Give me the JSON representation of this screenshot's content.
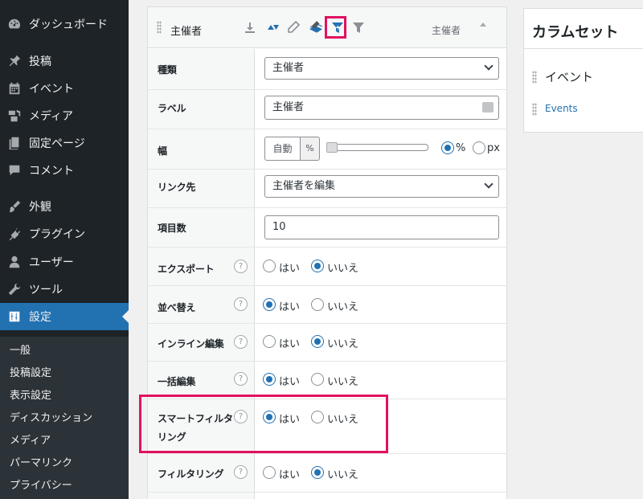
{
  "sidebar": {
    "items": [
      {
        "label": "ダッシュボード",
        "icon": "dashboard-icon"
      },
      {
        "label": "投稿",
        "icon": "pin-icon"
      },
      {
        "label": "イベント",
        "icon": "calendar-icon"
      },
      {
        "label": "メディア",
        "icon": "media-icon"
      },
      {
        "label": "固定ページ",
        "icon": "pages-icon"
      },
      {
        "label": "コメント",
        "icon": "comment-icon"
      },
      {
        "label": "外観",
        "icon": "brush-icon"
      },
      {
        "label": "プラグイン",
        "icon": "plugin-icon"
      },
      {
        "label": "ユーザー",
        "icon": "user-icon"
      },
      {
        "label": "ツール",
        "icon": "wrench-icon"
      },
      {
        "label": "設定",
        "icon": "settings-icon"
      }
    ],
    "submenu": [
      "一般",
      "投稿設定",
      "表示設定",
      "ディスカッション",
      "メディア",
      "パーマリンク",
      "プライバシー"
    ]
  },
  "column": {
    "header_title": "主催者",
    "header_label": "主催者",
    "icons": [
      "download-icon",
      "sort-icon",
      "edit-icon",
      "bulk-edit-icon",
      "smart-filter-icon",
      "filter-icon"
    ],
    "fields": {
      "type": {
        "label": "種類",
        "value": "主催者"
      },
      "column_label": {
        "label": "ラベル",
        "value": "主催者"
      },
      "width": {
        "label": "幅",
        "auto": "自動",
        "unit": "%",
        "options": [
          "%",
          "px"
        ],
        "selected": "%"
      },
      "link": {
        "label": "リンク先",
        "value": "主催者を編集"
      },
      "count": {
        "label": "項目数",
        "value": "10"
      },
      "export": {
        "label": "エクスポート",
        "selected": "いいえ"
      },
      "sort": {
        "label": "並べ替え",
        "selected": "はい"
      },
      "inline_edit": {
        "label": "インライン編集",
        "selected": "いいえ"
      },
      "bulk_edit": {
        "label": "一括編集",
        "selected": "はい"
      },
      "smart_filter": {
        "label_1": "スマートフィルタ",
        "label_2": "リング",
        "selected": "はい"
      },
      "filtering": {
        "label": "フィルタリング",
        "selected": "いいえ"
      }
    },
    "yes": "はい",
    "no": "いいえ",
    "help": "?"
  },
  "column_set": {
    "title": "カラムセット",
    "item": "イベント",
    "link": "Events"
  },
  "colors": {
    "sidebar_bg": "#1d2327",
    "active_bg": "#2271b1",
    "highlight": "#e0115f"
  }
}
